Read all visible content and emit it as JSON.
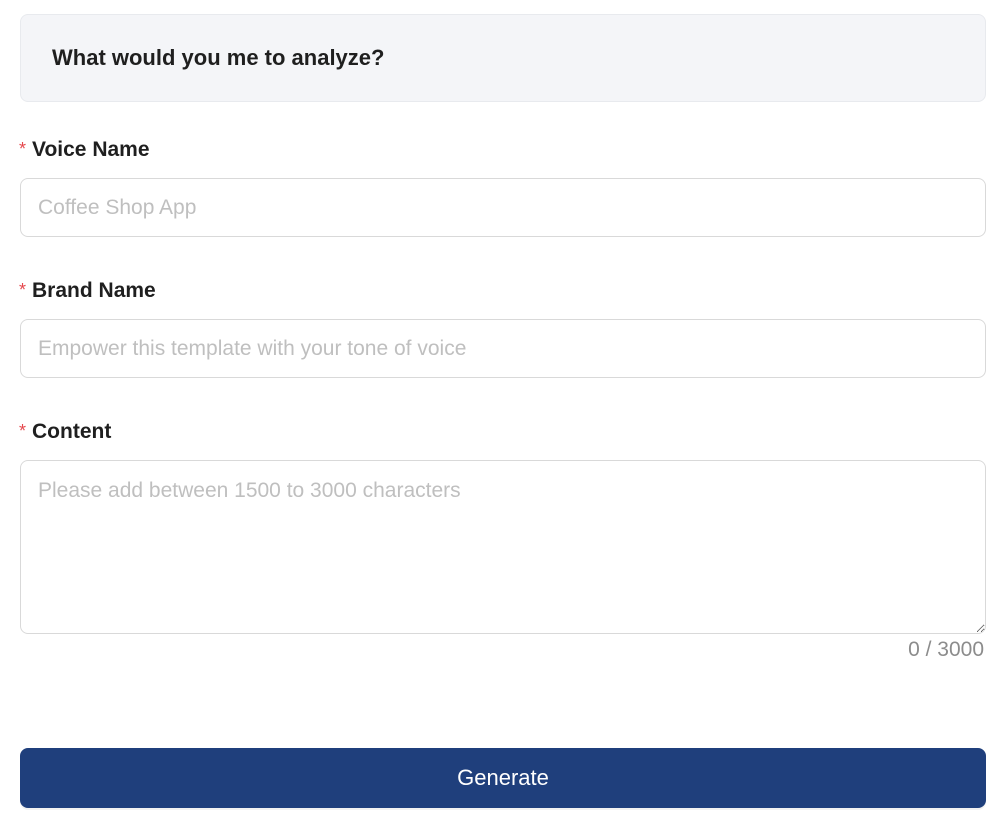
{
  "header": {
    "title": "What would you me to analyze?"
  },
  "form": {
    "required_marker": "*",
    "voice_name": {
      "label": "Voice Name",
      "value": "",
      "placeholder": "Coffee Shop App"
    },
    "brand_name": {
      "label": "Brand Name",
      "value": "",
      "placeholder": "Empower this template with your tone of voice"
    },
    "content": {
      "label": "Content",
      "value": "",
      "placeholder": "Please add between 1500 to 3000 characters",
      "char_count": "0 / 3000"
    },
    "generate_label": "Generate"
  },
  "colors": {
    "primary": "#1f3f7c",
    "required": "#e5484d",
    "header_bg": "#f4f5f8"
  }
}
